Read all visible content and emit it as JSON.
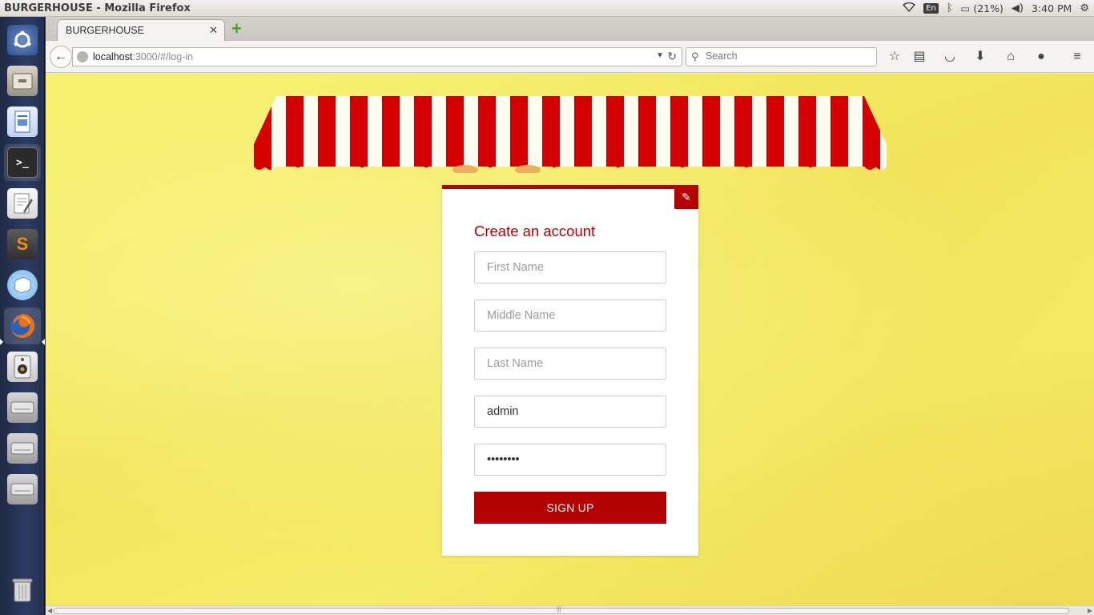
{
  "window": {
    "title": "BURGERHOUSE - Mozilla Firefox"
  },
  "tray": {
    "keyboard_layout": "En",
    "battery": "(21%)",
    "time": "3:40 PM",
    "icons": [
      "wifi-icon",
      "bluetooth-icon",
      "battery-icon",
      "volume-icon",
      "settings-gear-icon"
    ]
  },
  "launcher": {
    "items": [
      "ubuntu-dash-icon",
      "files-icon",
      "writer-icon",
      "terminal-icon",
      "text-editor-icon",
      "sublime-icon",
      "brain-app-icon",
      "firefox-icon",
      "speaker-icon",
      "drive-icon",
      "drive-icon",
      "drive-icon",
      "trash-icon"
    ]
  },
  "browser": {
    "tab_title": "BURGERHOUSE",
    "url_host": "localhost",
    "url_rest": ":3000/#/log-in",
    "search_placeholder": "Search"
  },
  "form": {
    "heading": "Create an account",
    "first_name_placeholder": "First Name",
    "middle_name_placeholder": "Middle Name",
    "last_name_placeholder": "Last Name",
    "username_value": "admin",
    "password_value": "password",
    "submit_label": "SIGN UP"
  },
  "colors": {
    "brand_red": "#b30000",
    "background_yellow": "#f4ea63"
  }
}
